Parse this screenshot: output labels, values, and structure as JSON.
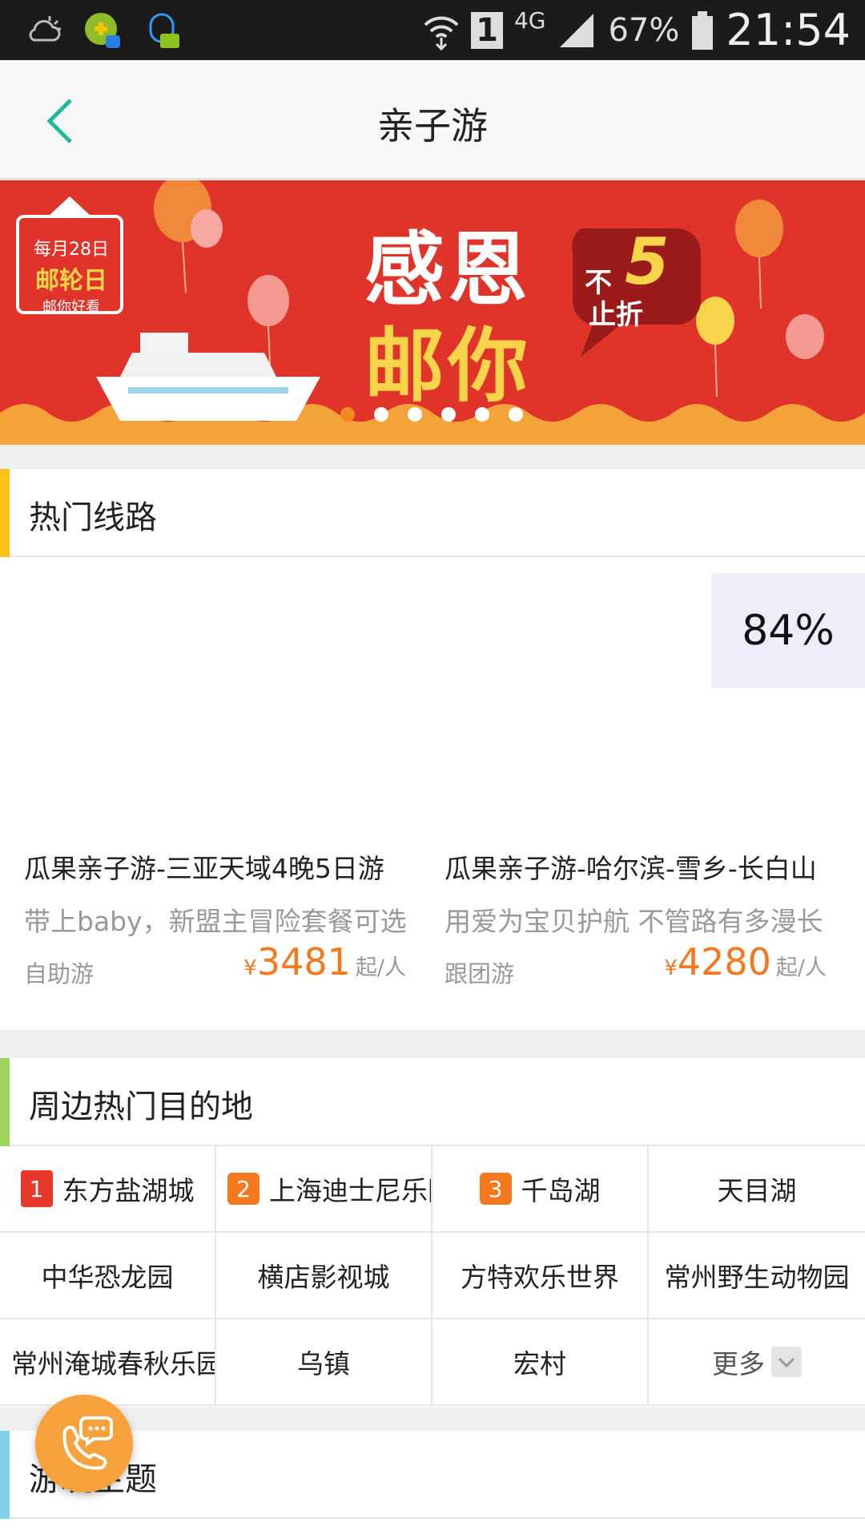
{
  "status_bar": {
    "battery": "67%",
    "network": "4G",
    "sim": "1",
    "time": "21:54"
  },
  "nav": {
    "title": "亲子游"
  },
  "banner": {
    "stamp_line1": "每月28日",
    "stamp_line2": "邮轮日",
    "stamp_line3": "邮你好看",
    "headline_1": "感恩",
    "headline_2": "邮你",
    "tag_top": "不",
    "tag_num": "5",
    "tag_bottom": "止折",
    "dots": 6,
    "active_dot": 0
  },
  "hot_routes": {
    "title": "热门线路",
    "bar_color": "#f8c21a",
    "items": [
      {
        "name": "瓜果亲子游-三亚天域4晚5日游",
        "desc": "带上baby，新盟主冒险套餐可选",
        "type": "自助游",
        "currency": "¥",
        "price": "3481",
        "unit": "起/人"
      },
      {
        "name": "瓜果亲子游-哈尔滨-雪乡-长白山",
        "desc": "用爱为宝贝护航 不管路有多漫长",
        "type": "跟团游",
        "currency": "¥",
        "price": "4280",
        "unit": "起/人"
      }
    ]
  },
  "progress_badge": "84%",
  "destinations": {
    "title": "周边热门目的地",
    "bar_color": "#9bd55d",
    "items": [
      {
        "rank": "1",
        "name": "东方盐湖城"
      },
      {
        "rank": "2",
        "name": "上海迪士尼乐园"
      },
      {
        "rank": "3",
        "name": "千岛湖"
      },
      {
        "rank": "",
        "name": "天目湖"
      },
      {
        "rank": "",
        "name": "中华恐龙园"
      },
      {
        "rank": "",
        "name": "横店影视城"
      },
      {
        "rank": "",
        "name": "方特欢乐世界"
      },
      {
        "rank": "",
        "name": "常州野生动物园"
      },
      {
        "rank": "",
        "name": "常州淹城春秋乐园"
      },
      {
        "rank": "",
        "name": "乌镇"
      },
      {
        "rank": "",
        "name": "宏村"
      }
    ],
    "more_label": "更多"
  },
  "themes": {
    "title": "游玩主题",
    "bar_color": "#7fd3e8"
  }
}
